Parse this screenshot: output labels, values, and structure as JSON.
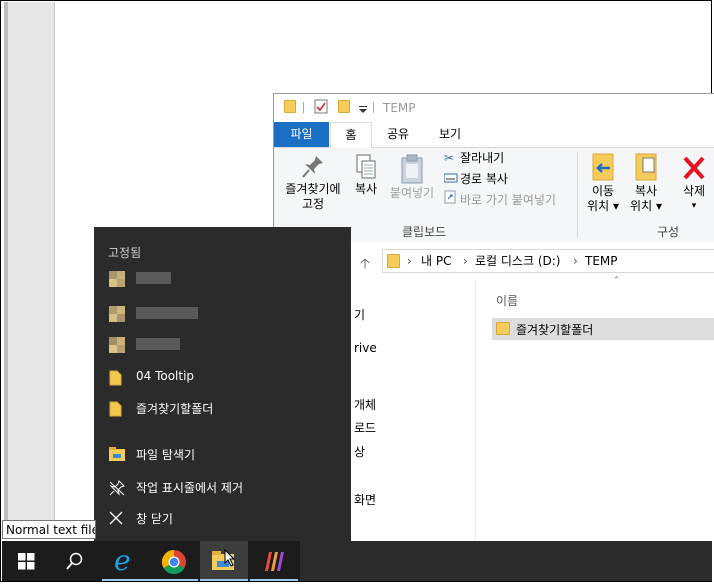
{
  "tooltip": {
    "text": "Normal text file"
  },
  "explorer": {
    "title": "TEMP",
    "tabs": [
      {
        "label": "파일"
      },
      {
        "label": "홈"
      },
      {
        "label": "공유"
      },
      {
        "label": "보기"
      }
    ],
    "clipboard": {
      "pin_label_1": "즐겨찾기에",
      "pin_label_2": "고정",
      "copy_label": "복사",
      "paste_label": "붙여넣기",
      "cut_label": "잘라내기",
      "copy_path_label": "경로 복사",
      "paste_shortcut_label": "바로 가기 붙여넣기",
      "group_label": "클립보드"
    },
    "organize": {
      "move_label_1": "이동",
      "move_label_2": "위치",
      "copyto_label_1": "복사",
      "copyto_label_2": "위치",
      "delete_label": "삭제",
      "group_label": "구성"
    },
    "address": {
      "seg1": "내 PC",
      "seg2": "로컬 디스크 (D:)",
      "seg3": "TEMP"
    },
    "nav_fragments": [
      "기",
      "rive",
      "개체",
      "로드",
      "상",
      "화면"
    ],
    "column_name": "이름",
    "items": [
      {
        "name": "즐겨찾기할폴더"
      }
    ]
  },
  "jumplist": {
    "header": "고정됨",
    "pinned": [
      {
        "label": "04 Tooltip"
      },
      {
        "label": "즐겨찾기할폴더"
      }
    ],
    "tasks": [
      {
        "label": "파일 탐색기"
      },
      {
        "label": "작업 표시줄에서 제거"
      },
      {
        "label": "창 닫기"
      }
    ]
  },
  "taskbar": {
    "items": [
      "windows-start",
      "search",
      "internet-explorer",
      "chrome",
      "file-explorer",
      "app-icon"
    ]
  },
  "colors": {
    "file_tab": "#1a6fc4",
    "jumplist_bg": "#2b2b2b",
    "taskbar_bg": "#1c1c1c",
    "folder": "#f5cc5a",
    "delete_red": "#e81123"
  }
}
